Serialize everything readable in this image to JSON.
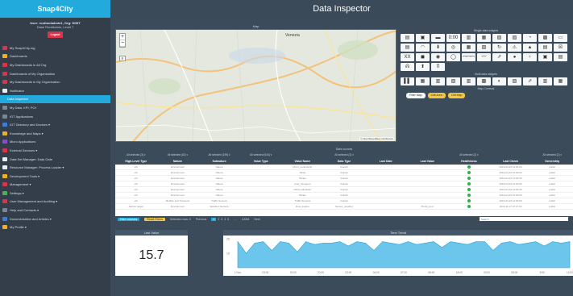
{
  "sidebar": {
    "brand": "Snap4City",
    "user_line1": "User: roottooladmin1, Org: DISIT",
    "user_line2": "Dose RootAdmin, Level 7",
    "logout_label": "Logout",
    "items": [
      {
        "label": "My Snap4City.org",
        "color": "c-red"
      },
      {
        "label": "Dashboards",
        "color": "c-yel"
      },
      {
        "label": "My Dashboards in All Org",
        "color": "c-red"
      },
      {
        "label": "Dashboards of My Organization",
        "color": "c-red"
      },
      {
        "label": "My Dashboards in My Organization",
        "color": "c-red"
      },
      {
        "label": "Notificator",
        "color": "c-wht"
      },
      {
        "label": "Data Inspector",
        "color": "",
        "active": true
      },
      {
        "label": "My Data, KPI, POI",
        "color": "c-gry"
      },
      {
        "label": "IOT Applications",
        "color": "c-gry"
      },
      {
        "label": "IOT Directory and Devices ▾",
        "color": "c-blu"
      },
      {
        "label": "Knowledge and Maps ▾",
        "color": "c-yel"
      },
      {
        "label": "Micro Applications",
        "color": "c-prp"
      },
      {
        "label": "External Services ▾",
        "color": "c-red"
      },
      {
        "label": "Data Set Manager: Data Gate",
        "color": "c-wht"
      },
      {
        "label": "Resource Manager: Process Loader ▾",
        "color": "c-wht"
      },
      {
        "label": "Development Tools ▾",
        "color": "c-yel"
      },
      {
        "label": "Management ▾",
        "color": "c-red"
      },
      {
        "label": "Settings ▾",
        "color": "c-grn"
      },
      {
        "label": "User Management and Auditing ▾",
        "color": "c-red"
      },
      {
        "label": "Help and Contacts ▾",
        "color": "c-gry"
      },
      {
        "label": "Documentation and Articles ▾",
        "color": "c-blu"
      },
      {
        "label": "My Profile ▾",
        "color": "c-yel"
      }
    ]
  },
  "header": {
    "title": "Data Inspector"
  },
  "map": {
    "label": "Map",
    "zoom_in": "+",
    "zoom_out": "−",
    "layers_icon": "layers-icon",
    "city_label": "Venezia",
    "attribution": "© OpenStreetMap contributors"
  },
  "widgets": {
    "single_label": "Single data widgets",
    "multi_label": "Multi data widgets",
    "controls_label": "Map Controls",
    "single_icons": [
      "▤",
      "▣",
      "▬",
      "0:00",
      "▥",
      "▦",
      "▧",
      "▨",
      "◔",
      "▩",
      "▭",
      "▤",
      "◠",
      "⬇",
      "◎",
      "▦",
      "▧",
      "↻",
      "⚠",
      "▲",
      "▤",
      "☒",
      "XX",
      "◼",
      "◉",
      "◯",
      "ꟷꟷꟷ",
      "〰",
      "⇗",
      "●",
      "♀",
      "▣",
      "▤",
      "ᕱ",
      "⬆",
      "Ⴖ"
    ],
    "multi_icons": [
      "▌▌",
      "▦",
      "▥",
      "▧",
      "▥",
      "▩",
      "◐",
      "▨",
      "⇗",
      "▥",
      "▦"
    ],
    "controls": [
      {
        "label": "Filter Map",
        "style": "light"
      },
      {
        "label": "Cliff Area",
        "style": "gold"
      },
      {
        "label": "Cliff Map",
        "style": "gold"
      }
    ]
  },
  "table": {
    "caption": "Data sources",
    "selectors": [
      "All selected (3) ▾",
      "All selected (82) ▾",
      "All selected (195) ▾",
      "All selected (544) ▾",
      "",
      "All selected (2) ▾",
      "",
      "",
      "All selected (2) ▾",
      "",
      "All selected (2) ▾"
    ],
    "headers": [
      "High-Level Type",
      "Nature",
      "Subnature",
      "Value Type",
      "Value Name",
      "Data Type",
      "Last Date",
      "Last Value",
      "Healthiness",
      "Last Check",
      "Ownership"
    ],
    "rows": [
      [
        "urb",
        "Environment",
        "Nature",
        "",
        "ph.mt_controlsmrt",
        "Gravini",
        "",
        "",
        "",
        "2019-04-16 12:00:00",
        "public"
      ],
      [
        "urb",
        "Environment",
        "Nature",
        "",
        "Nitrite",
        "Gravini",
        "",
        "",
        "",
        "2019-04-16 12:00:00",
        "public"
      ],
      [
        "urb",
        "Environment",
        "Nature",
        "",
        "Nitrato",
        "Gravini",
        "",
        "",
        "",
        "2019-04-16 12:00:00",
        "public"
      ],
      [
        "urb",
        "Environment",
        "Nature",
        "",
        "pred_nitrogeno",
        "Gravini",
        "",
        "",
        "",
        "2019-04-16 12:00:00",
        "public"
      ],
      [
        "urb",
        "Environment",
        "Nature",
        "",
        "Nitrito-calcolatur",
        "Gravini",
        "",
        "",
        "",
        "2019-04-16 12:00:00",
        "public"
      ],
      [
        "urb",
        "Environment",
        "Nature",
        "",
        "Nitrato",
        "Gravini",
        "",
        "",
        "",
        "2019-04-16 12:00:00",
        "public"
      ],
      [
        "urb",
        "Mobility and Transport",
        "Traffic Sensors",
        "",
        "Traffic Sensors",
        "Gravini",
        "",
        "",
        "",
        "2019-04-16 12:00:00",
        "public"
      ],
      [
        "Sensor target",
        "Environment",
        "Weather Sensors",
        "",
        "Dew_degree",
        "Sensor_weather",
        "",
        "Plenty_ks.d",
        "",
        "2019-11-17 07:17:00",
        "public"
      ]
    ],
    "footer": {
      "hide_columns": "Hide columns",
      "reset_filters": "Reset Filters",
      "selected_rows": "Selected rows: 0",
      "previous": "Previous",
      "pages": [
        "1",
        "2",
        "3",
        "4",
        "5"
      ],
      "ellipsis": "…",
      "last_page": "12064",
      "next": "Next",
      "search_placeholder": "Search"
    }
  },
  "last_value": {
    "label": "Last Value",
    "value": "15.7"
  },
  "trend": {
    "label": "Time Trend",
    "y_ticks": [
      "20",
      "10"
    ],
    "x_ticks": [
      "1 Nov",
      "03:30",
      "20:00",
      "20:30",
      "23:00",
      "04:00",
      "07:30",
      "08:00",
      "18:00",
      "20:00",
      "08:00",
      "9:50",
      "12:00"
    ]
  },
  "chart_data": {
    "type": "area",
    "title": "Time Trend",
    "x": [
      "1 Nov",
      "03:30",
      "20:00",
      "20:30",
      "23:00",
      "04:00",
      "07:30",
      "08:00",
      "18:00",
      "20:00",
      "08:00",
      "9:50",
      "12:00"
    ],
    "series": [
      {
        "values": [
          18,
          10,
          17,
          18,
          12,
          18,
          17,
          11,
          18,
          16,
          17,
          17,
          18,
          15,
          18,
          17,
          12,
          18,
          17,
          16,
          18,
          16,
          17,
          18,
          14,
          18,
          17,
          16,
          18,
          18,
          12,
          17,
          18,
          16,
          17,
          18,
          15,
          18,
          17,
          18
        ]
      }
    ],
    "ylim": [
      0,
      20
    ],
    "colors": {
      "fill": "#6cc5ea",
      "stroke": "#2fa3d7"
    }
  }
}
